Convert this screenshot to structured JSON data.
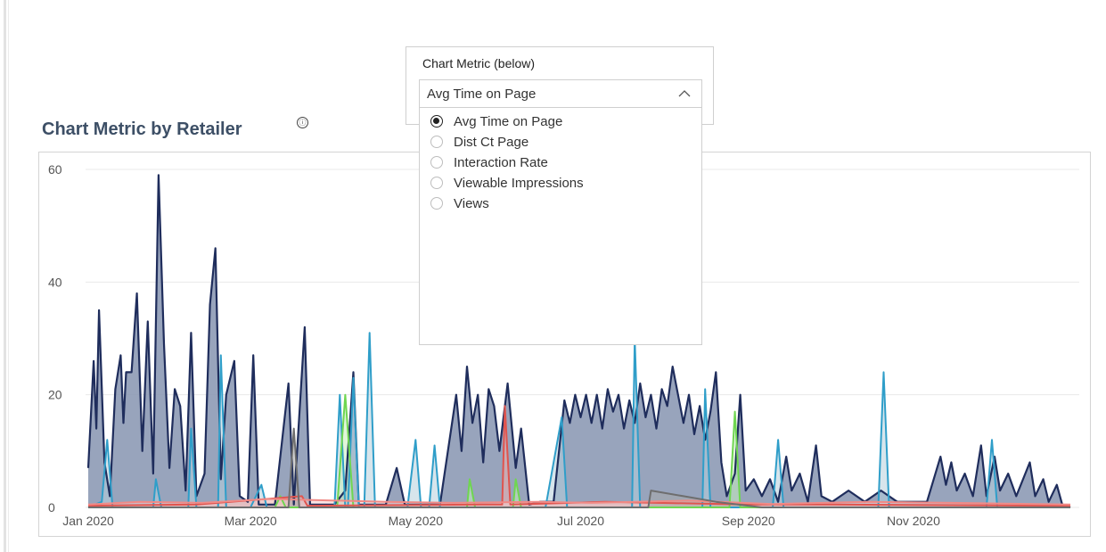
{
  "chart": {
    "title": "Chart Metric by Retailer",
    "info_glyph": "ⓘ"
  },
  "metric_selector": {
    "label": "Chart Metric (below)",
    "selected": "Avg Time on Page",
    "expanded": true,
    "options": [
      {
        "label": "Avg Time on Page",
        "checked": true
      },
      {
        "label": "Dist Ct Page",
        "checked": false
      },
      {
        "label": "Interaction Rate",
        "checked": false
      },
      {
        "label": "Viewable Impressions",
        "checked": false
      },
      {
        "label": "Views",
        "checked": false
      }
    ]
  },
  "colors": {
    "grid": "#e9e9e9",
    "axis_text": "#555555",
    "accent_text": "#3d4f66"
  },
  "chart_data": {
    "type": "area",
    "title": "Chart Metric by Retailer",
    "xlabel": "",
    "ylabel": "",
    "ylim": [
      0,
      60
    ],
    "y_ticks": [
      0,
      20,
      40,
      60
    ],
    "x_ticks": [
      "Jan 2020",
      "Mar 2020",
      "May 2020",
      "Jul 2020",
      "Sep 2020",
      "Nov 2020"
    ],
    "x_range": [
      "2020-01-01",
      "2020-12-29"
    ],
    "grid": true,
    "legend": "none",
    "series": [
      {
        "color": "#1f2d5c",
        "fill": "#8d9ab5",
        "points": [
          [
            "2020-01-01",
            7
          ],
          [
            "2020-01-03",
            26
          ],
          [
            "2020-01-04",
            14
          ],
          [
            "2020-01-05",
            35
          ],
          [
            "2020-01-07",
            8
          ],
          [
            "2020-01-09",
            2
          ],
          [
            "2020-01-11",
            21
          ],
          [
            "2020-01-13",
            27
          ],
          [
            "2020-01-14",
            15
          ],
          [
            "2020-01-15",
            24
          ],
          [
            "2020-01-17",
            24
          ],
          [
            "2020-01-19",
            38
          ],
          [
            "2020-01-21",
            10
          ],
          [
            "2020-01-23",
            33
          ],
          [
            "2020-01-25",
            6
          ],
          [
            "2020-01-27",
            59
          ],
          [
            "2020-01-29",
            29
          ],
          [
            "2020-01-31",
            7
          ],
          [
            "2020-02-02",
            21
          ],
          [
            "2020-02-04",
            18
          ],
          [
            "2020-02-06",
            3
          ],
          [
            "2020-02-08",
            31
          ],
          [
            "2020-02-10",
            2
          ],
          [
            "2020-02-13",
            6
          ],
          [
            "2020-02-15",
            36
          ],
          [
            "2020-02-17",
            46
          ],
          [
            "2020-02-19",
            5
          ],
          [
            "2020-02-21",
            20
          ],
          [
            "2020-02-24",
            26
          ],
          [
            "2020-02-26",
            2
          ],
          [
            "2020-02-29",
            1
          ],
          [
            "2020-03-02",
            27
          ],
          [
            "2020-03-04",
            0.5
          ],
          [
            "2020-03-10",
            0.5
          ],
          [
            "2020-03-15",
            22
          ],
          [
            "2020-03-17",
            0.5
          ],
          [
            "2020-03-21",
            32
          ],
          [
            "2020-03-23",
            0.5
          ],
          [
            "2020-04-01",
            0.5
          ],
          [
            "2020-04-05",
            3
          ],
          [
            "2020-04-08",
            24
          ],
          [
            "2020-04-10",
            0.5
          ],
          [
            "2020-04-20",
            0.5
          ],
          [
            "2020-04-24",
            7
          ],
          [
            "2020-04-27",
            0.5
          ],
          [
            "2020-05-10",
            0.5
          ],
          [
            "2020-05-16",
            20
          ],
          [
            "2020-05-18",
            10
          ],
          [
            "2020-05-20",
            25
          ],
          [
            "2020-05-22",
            15
          ],
          [
            "2020-05-24",
            20
          ],
          [
            "2020-05-26",
            8
          ],
          [
            "2020-05-28",
            21
          ],
          [
            "2020-05-30",
            18
          ],
          [
            "2020-06-01",
            10
          ],
          [
            "2020-06-04",
            22
          ],
          [
            "2020-06-07",
            7
          ],
          [
            "2020-06-09",
            14
          ],
          [
            "2020-06-12",
            0.5
          ],
          [
            "2020-06-16",
            1
          ],
          [
            "2020-06-21",
            1
          ],
          [
            "2020-06-25",
            19
          ],
          [
            "2020-06-27",
            15
          ],
          [
            "2020-06-29",
            20
          ],
          [
            "2020-07-01",
            16
          ],
          [
            "2020-07-03",
            20
          ],
          [
            "2020-07-05",
            15
          ],
          [
            "2020-07-07",
            20
          ],
          [
            "2020-07-09",
            14
          ],
          [
            "2020-07-11",
            21
          ],
          [
            "2020-07-13",
            17
          ],
          [
            "2020-07-15",
            20
          ],
          [
            "2020-07-17",
            14
          ],
          [
            "2020-07-19",
            19
          ],
          [
            "2020-07-21",
            15
          ],
          [
            "2020-07-23",
            22
          ],
          [
            "2020-07-25",
            16
          ],
          [
            "2020-07-27",
            20
          ],
          [
            "2020-07-29",
            14
          ],
          [
            "2020-07-31",
            21
          ],
          [
            "2020-08-02",
            18
          ],
          [
            "2020-08-04",
            25
          ],
          [
            "2020-08-06",
            20
          ],
          [
            "2020-08-08",
            15
          ],
          [
            "2020-08-10",
            20
          ],
          [
            "2020-08-12",
            13
          ],
          [
            "2020-08-14",
            18
          ],
          [
            "2020-08-16",
            12
          ],
          [
            "2020-08-18",
            17
          ],
          [
            "2020-08-20",
            24
          ],
          [
            "2020-08-22",
            8
          ],
          [
            "2020-08-24",
            2
          ],
          [
            "2020-08-27",
            6
          ],
          [
            "2020-08-29",
            20
          ],
          [
            "2020-08-31",
            3
          ],
          [
            "2020-09-03",
            5
          ],
          [
            "2020-09-06",
            2
          ],
          [
            "2020-09-09",
            5
          ],
          [
            "2020-09-12",
            1
          ],
          [
            "2020-09-15",
            9
          ],
          [
            "2020-09-17",
            3
          ],
          [
            "2020-09-20",
            6
          ],
          [
            "2020-09-23",
            1
          ],
          [
            "2020-09-26",
            11
          ],
          [
            "2020-09-28",
            2
          ],
          [
            "2020-10-02",
            1
          ],
          [
            "2020-10-08",
            3
          ],
          [
            "2020-10-14",
            1
          ],
          [
            "2020-10-20",
            3
          ],
          [
            "2020-10-26",
            1
          ],
          [
            "2020-11-01",
            1
          ],
          [
            "2020-11-06",
            1
          ],
          [
            "2020-11-11",
            9
          ],
          [
            "2020-11-13",
            4
          ],
          [
            "2020-11-15",
            8
          ],
          [
            "2020-11-17",
            3
          ],
          [
            "2020-11-20",
            6
          ],
          [
            "2020-11-23",
            2
          ],
          [
            "2020-11-26",
            11
          ],
          [
            "2020-11-28",
            2
          ],
          [
            "2020-12-01",
            9
          ],
          [
            "2020-12-03",
            3
          ],
          [
            "2020-12-06",
            6
          ],
          [
            "2020-12-09",
            2
          ],
          [
            "2020-12-14",
            8
          ],
          [
            "2020-12-16",
            2
          ],
          [
            "2020-12-19",
            5
          ],
          [
            "2020-12-21",
            1
          ],
          [
            "2020-12-24",
            4
          ],
          [
            "2020-12-26",
            0.5
          ],
          [
            "2020-12-29",
            0
          ]
        ]
      },
      {
        "color": "#2f9ec9",
        "fill": "#b7cfdc",
        "points": [
          [
            "2020-01-01",
            0
          ],
          [
            "2020-01-06",
            1
          ],
          [
            "2020-01-08",
            12
          ],
          [
            "2020-01-10",
            0
          ],
          [
            "2020-01-25",
            0
          ],
          [
            "2020-01-26",
            5
          ],
          [
            "2020-01-28",
            0
          ],
          [
            "2020-02-07",
            0
          ],
          [
            "2020-02-08",
            14
          ],
          [
            "2020-02-10",
            0
          ],
          [
            "2020-02-18",
            0
          ],
          [
            "2020-02-19",
            27
          ],
          [
            "2020-02-21",
            0
          ],
          [
            "2020-03-01",
            0
          ],
          [
            "2020-03-05",
            4
          ],
          [
            "2020-03-07",
            0
          ],
          [
            "2020-04-01",
            0
          ],
          [
            "2020-04-03",
            20
          ],
          [
            "2020-04-05",
            0
          ],
          [
            "2020-04-06",
            0
          ],
          [
            "2020-04-08",
            23
          ],
          [
            "2020-04-10",
            0
          ],
          [
            "2020-04-12",
            0
          ],
          [
            "2020-04-14",
            31
          ],
          [
            "2020-04-16",
            0
          ],
          [
            "2020-04-28",
            0
          ],
          [
            "2020-05-01",
            12
          ],
          [
            "2020-05-03",
            0
          ],
          [
            "2020-05-06",
            0
          ],
          [
            "2020-05-08",
            11
          ],
          [
            "2020-05-10",
            0
          ],
          [
            "2020-06-18",
            0
          ],
          [
            "2020-06-24",
            16
          ],
          [
            "2020-06-26",
            0
          ],
          [
            "2020-07-20",
            0
          ],
          [
            "2020-07-21",
            30
          ],
          [
            "2020-07-23",
            0
          ],
          [
            "2020-08-15",
            0
          ],
          [
            "2020-08-16",
            21
          ],
          [
            "2020-08-18",
            0
          ],
          [
            "2020-09-10",
            0
          ],
          [
            "2020-09-12",
            12
          ],
          [
            "2020-09-14",
            0
          ],
          [
            "2020-10-19",
            0
          ],
          [
            "2020-10-21",
            24
          ],
          [
            "2020-10-23",
            0
          ],
          [
            "2020-11-28",
            0
          ],
          [
            "2020-11-30",
            12
          ],
          [
            "2020-12-02",
            0
          ],
          [
            "2020-12-29",
            0
          ]
        ]
      },
      {
        "color": "#6fd651",
        "fill": "#c9ecbd",
        "points": [
          [
            "2020-01-01",
            0
          ],
          [
            "2020-03-10",
            0
          ],
          [
            "2020-03-12",
            2
          ],
          [
            "2020-03-14",
            0
          ],
          [
            "2020-04-02",
            0
          ],
          [
            "2020-04-05",
            20
          ],
          [
            "2020-04-08",
            0
          ],
          [
            "2020-05-20",
            0
          ],
          [
            "2020-05-21",
            5
          ],
          [
            "2020-05-23",
            0
          ],
          [
            "2020-06-06",
            0
          ],
          [
            "2020-06-07",
            5
          ],
          [
            "2020-06-09",
            0
          ],
          [
            "2020-08-25",
            0
          ],
          [
            "2020-08-27",
            17
          ],
          [
            "2020-08-29",
            0
          ],
          [
            "2020-12-29",
            0
          ]
        ]
      },
      {
        "color": "#e0544e",
        "fill": "#f0b1ad",
        "points": [
          [
            "2020-01-01",
            0.3
          ],
          [
            "2020-02-10",
            0.5
          ],
          [
            "2020-03-20",
            2
          ],
          [
            "2020-03-22",
            0.3
          ],
          [
            "2020-05-25",
            0.5
          ],
          [
            "2020-06-02",
            0.5
          ],
          [
            "2020-06-03",
            18
          ],
          [
            "2020-06-05",
            0.5
          ],
          [
            "2020-07-10",
            1
          ],
          [
            "2020-09-01",
            0.5
          ],
          [
            "2020-10-01",
            0.5
          ],
          [
            "2020-12-29",
            0.3
          ]
        ]
      },
      {
        "color": "#f08a86",
        "fill": "#f7cfcd",
        "points": [
          [
            "2020-01-01",
            0.5
          ],
          [
            "2020-01-20",
            1
          ],
          [
            "2020-02-12",
            0.8
          ],
          [
            "2020-03-08",
            1.5
          ],
          [
            "2020-04-20",
            1
          ],
          [
            "2020-05-15",
            0.8
          ],
          [
            "2020-06-15",
            1
          ],
          [
            "2020-07-05",
            0.8
          ],
          [
            "2020-08-10",
            1.2
          ],
          [
            "2020-09-10",
            0.6
          ],
          [
            "2020-10-15",
            1
          ],
          [
            "2020-11-15",
            0.8
          ],
          [
            "2020-12-29",
            0.5
          ]
        ]
      },
      {
        "color": "#6e6e6e",
        "fill": "#a7a7a7",
        "points": [
          [
            "2020-01-01",
            0
          ],
          [
            "2020-03-15",
            0
          ],
          [
            "2020-03-17",
            14
          ],
          [
            "2020-03-19",
            0
          ],
          [
            "2020-07-26",
            0
          ],
          [
            "2020-07-27",
            3
          ],
          [
            "2020-08-08",
            2
          ],
          [
            "2020-08-20",
            1
          ],
          [
            "2020-09-06",
            0
          ],
          [
            "2020-12-29",
            0
          ]
        ]
      }
    ]
  }
}
